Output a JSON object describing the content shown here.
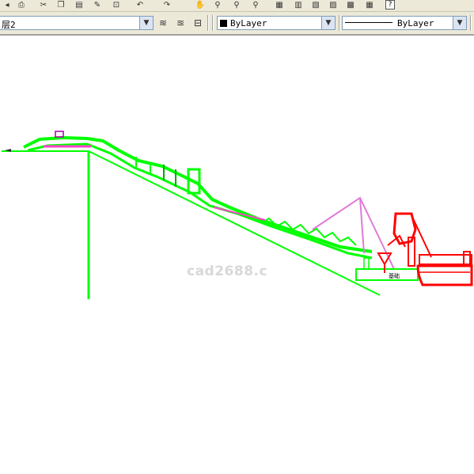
{
  "toolbar": {
    "help_label": "?",
    "icons": [
      "undo-icon",
      "redo-icon",
      "pan-icon",
      "zoom-realtime-icon",
      "zoom-window-icon",
      "zoom-previous-icon",
      "properties-icon",
      "design-center-icon",
      "tool-palettes-icon",
      "sheet-set-icon",
      "markup-icon",
      "calculator-icon"
    ]
  },
  "layer_bar": {
    "layer_value": "层2",
    "color_value": "ByLayer",
    "linetype_value": "ByLayer",
    "color_swatch": "#000000"
  },
  "drawing": {
    "watermark": "cad2688.c",
    "label_text": "基础",
    "colors": {
      "green": "#00ff00",
      "magenta": "#ff66cc",
      "pink": "#e080e0",
      "red": "#ff0000"
    }
  }
}
